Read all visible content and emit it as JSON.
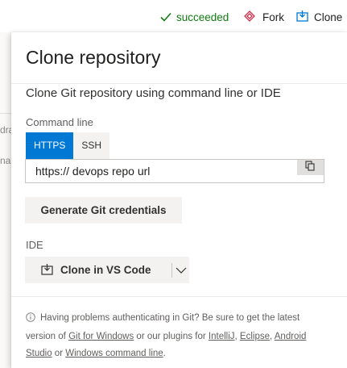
{
  "toolbar": {
    "status_label": "succeeded",
    "fork_label": "Fork",
    "clone_label": "Clone",
    "colors": {
      "success": "#107c10",
      "fork_icon": "#c4314b",
      "clone_icon": "#0078d4"
    },
    "icons": [
      "check-icon",
      "fork-icon",
      "clone-icon"
    ]
  },
  "underlay": {
    "fragment1": "dra",
    "fragment2": "nal"
  },
  "panel": {
    "title": "Clone repository",
    "subtitle": "Clone Git repository using command line or IDE",
    "command_line": {
      "label": "Command line",
      "tabs": [
        {
          "label": "HTTPS",
          "selected": true
        },
        {
          "label": "SSH",
          "selected": false
        }
      ],
      "url_value": "https:// devops repo url",
      "copy_icon": "copy-icon"
    },
    "generate_button": "Generate Git credentials",
    "ide": {
      "label": "IDE",
      "clone_button": "Clone in VS Code",
      "icons": [
        "clone-vscode-icon",
        "chevron-down-icon"
      ]
    },
    "help": {
      "prefix": "Having problems authenticating in Git? Be sure to get the latest version of ",
      "link_git_windows": "Git for Windows",
      "middle": " or our plugins for ",
      "link_intellij": "IntelliJ",
      "sep1": ", ",
      "link_eclipse": "Eclipse",
      "sep2": ", ",
      "link_android": "Android Studio",
      "sep3": " or ",
      "link_cmd": "Windows command line",
      "suffix": "."
    },
    "accent_color": "#0078d4"
  }
}
